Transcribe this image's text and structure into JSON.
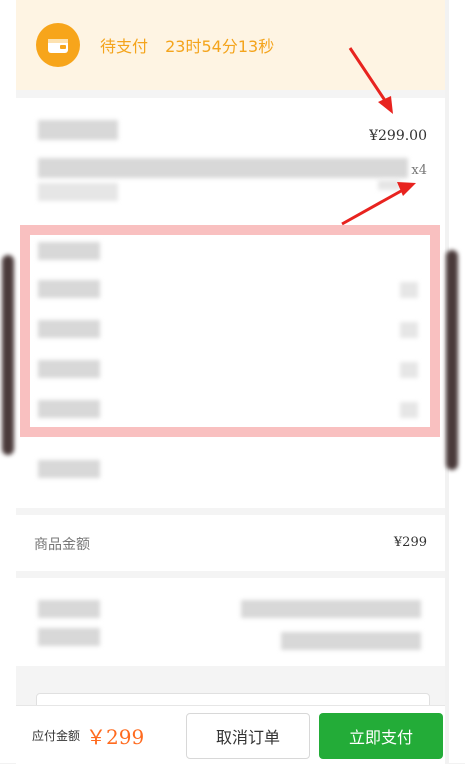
{
  "status": {
    "label": "待支付",
    "countdown": "23时54分13秒",
    "icon": "wallet-icon",
    "color": "#f4a41c"
  },
  "product": {
    "price": "¥299.00",
    "quantity": "x4"
  },
  "summary": {
    "goods_amount_label": "商品金额",
    "goods_amount_value": "¥299"
  },
  "footer": {
    "due_label": "应付金额",
    "due_value": "￥299",
    "cancel_label": "取消订单",
    "pay_label": "立即支付",
    "pay_color": "#23ac38"
  }
}
